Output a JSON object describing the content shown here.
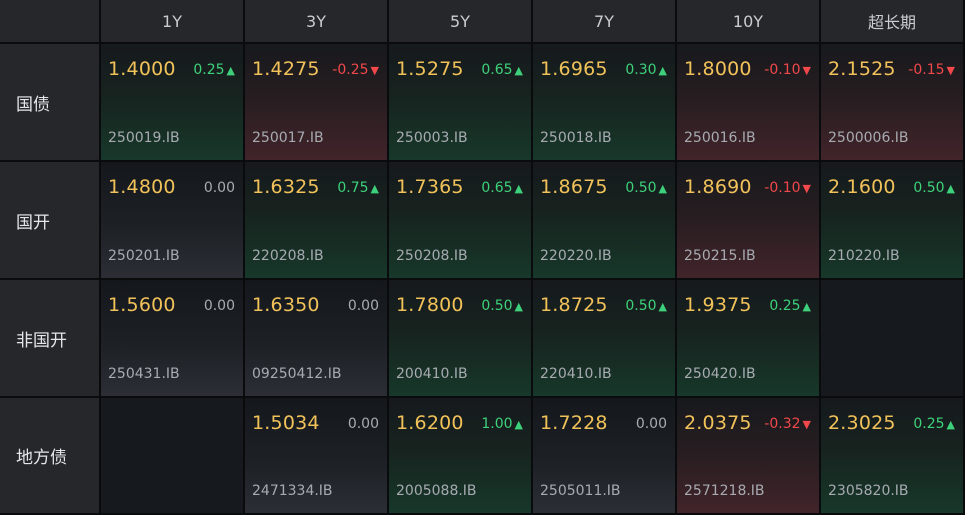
{
  "columns": [
    "1Y",
    "3Y",
    "5Y",
    "7Y",
    "10Y",
    "超长期"
  ],
  "colors": {
    "yield": "#f1c25a",
    "up": "#3ed17b",
    "down": "#f0484b",
    "flat": "#a8acb2"
  },
  "icons": {
    "up": "▲",
    "down": "▼"
  },
  "rows": [
    {
      "name": "国债",
      "cells": [
        {
          "yield": "1.4000",
          "change": "0.25",
          "dir": "up",
          "code": "250019.IB"
        },
        {
          "yield": "1.4275",
          "change": "-0.25",
          "dir": "down",
          "code": "250017.IB"
        },
        {
          "yield": "1.5275",
          "change": "0.65",
          "dir": "up",
          "code": "250003.IB"
        },
        {
          "yield": "1.6965",
          "change": "0.30",
          "dir": "up",
          "code": "250018.IB"
        },
        {
          "yield": "1.8000",
          "change": "-0.10",
          "dir": "down",
          "code": "250016.IB"
        },
        {
          "yield": "2.1525",
          "change": "-0.15",
          "dir": "down",
          "code": "2500006.IB"
        }
      ]
    },
    {
      "name": "国开",
      "cells": [
        {
          "yield": "1.4800",
          "change": "0.00",
          "dir": "flat",
          "code": "250201.IB"
        },
        {
          "yield": "1.6325",
          "change": "0.75",
          "dir": "up",
          "code": "220208.IB"
        },
        {
          "yield": "1.7365",
          "change": "0.65",
          "dir": "up",
          "code": "250208.IB"
        },
        {
          "yield": "1.8675",
          "change": "0.50",
          "dir": "up",
          "code": "220220.IB"
        },
        {
          "yield": "1.8690",
          "change": "-0.10",
          "dir": "down",
          "code": "250215.IB"
        },
        {
          "yield": "2.1600",
          "change": "0.50",
          "dir": "up",
          "code": "210220.IB"
        }
      ]
    },
    {
      "name": "非国开",
      "cells": [
        {
          "yield": "1.5600",
          "change": "0.00",
          "dir": "flat",
          "code": "250431.IB"
        },
        {
          "yield": "1.6350",
          "change": "0.00",
          "dir": "flat",
          "code": "09250412.IB"
        },
        {
          "yield": "1.7800",
          "change": "0.50",
          "dir": "up",
          "code": "200410.IB"
        },
        {
          "yield": "1.8725",
          "change": "0.50",
          "dir": "up",
          "code": "220410.IB"
        },
        {
          "yield": "1.9375",
          "change": "0.25",
          "dir": "up",
          "code": "250420.IB"
        },
        null
      ]
    },
    {
      "name": "地方债",
      "cells": [
        null,
        {
          "yield": "1.5034",
          "change": "0.00",
          "dir": "flat",
          "code": "2471334.IB"
        },
        {
          "yield": "1.6200",
          "change": "1.00",
          "dir": "up",
          "code": "2005088.IB"
        },
        {
          "yield": "1.7228",
          "change": "0.00",
          "dir": "flat",
          "code": "2505011.IB"
        },
        {
          "yield": "2.0375",
          "change": "-0.32",
          "dir": "down",
          "code": "2571218.IB"
        },
        {
          "yield": "2.3025",
          "change": "0.25",
          "dir": "up",
          "code": "2305820.IB"
        }
      ]
    }
  ]
}
